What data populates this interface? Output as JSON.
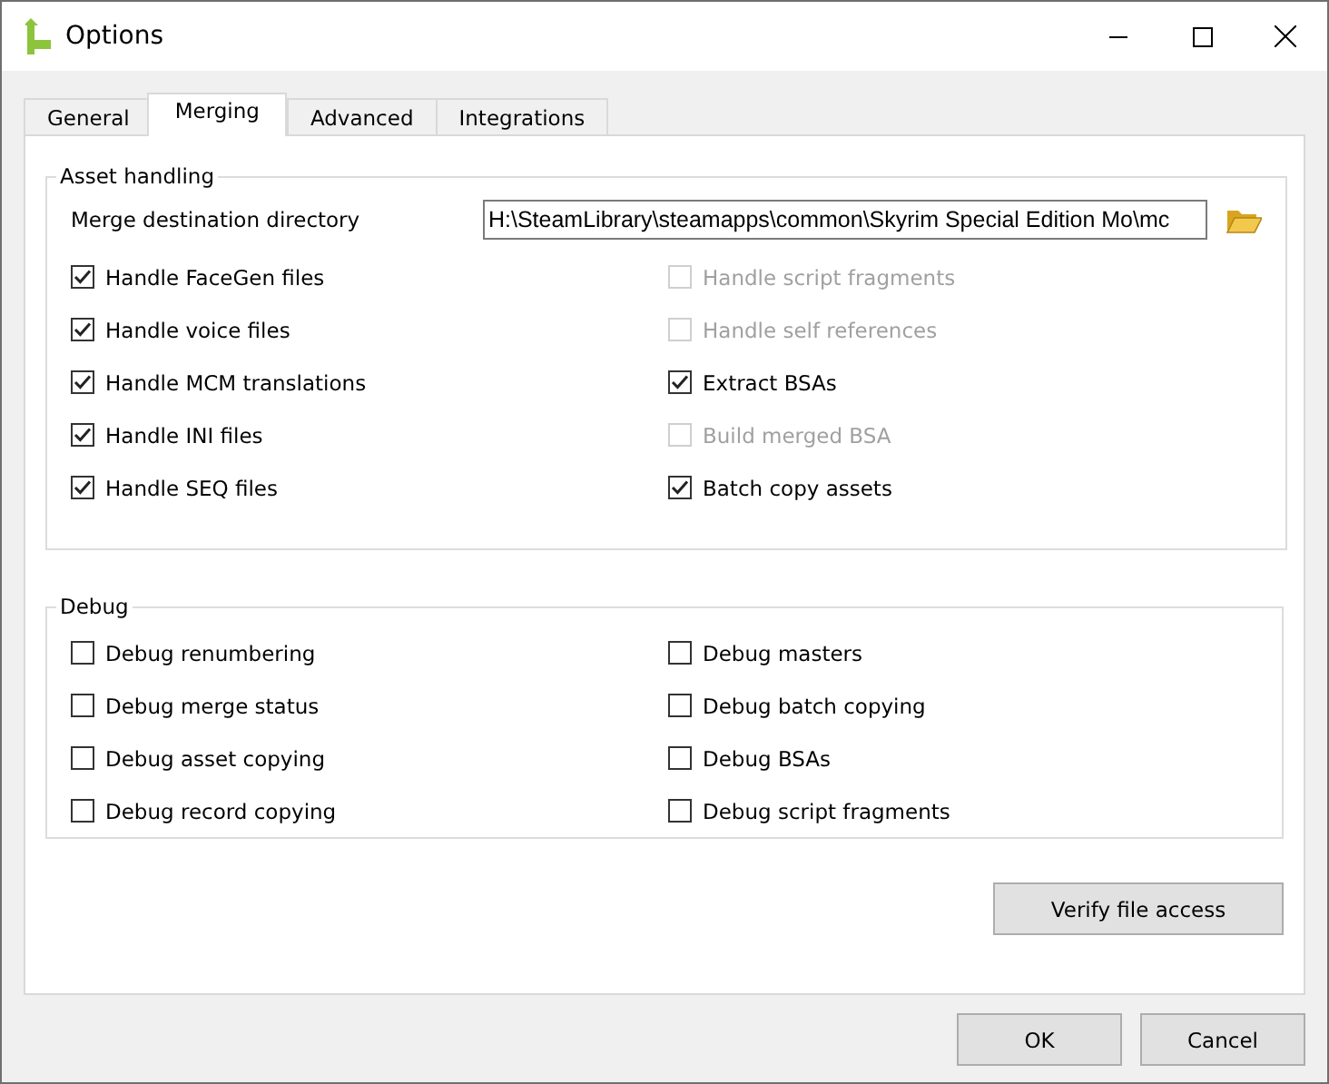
{
  "window": {
    "title": "Options"
  },
  "tabs": [
    {
      "label": "General",
      "selected": false
    },
    {
      "label": "Merging",
      "selected": true
    },
    {
      "label": "Advanced",
      "selected": false
    },
    {
      "label": "Integrations",
      "selected": false
    }
  ],
  "asset_handling": {
    "title": "Asset handling",
    "directory_label": "Merge destination directory",
    "directory_value": "H:\\SteamLibrary\\steamapps\\common\\Skyrim Special Edition Mo\\mc",
    "left_options": [
      {
        "label": "Handle FaceGen files",
        "checked": true,
        "disabled": false
      },
      {
        "label": "Handle voice files",
        "checked": true,
        "disabled": false
      },
      {
        "label": "Handle MCM translations",
        "checked": true,
        "disabled": false
      },
      {
        "label": "Handle INI files",
        "checked": true,
        "disabled": false
      },
      {
        "label": "Handle SEQ files",
        "checked": true,
        "disabled": false
      }
    ],
    "right_options": [
      {
        "label": "Handle script fragments",
        "checked": false,
        "disabled": true
      },
      {
        "label": "Handle self references",
        "checked": false,
        "disabled": true
      },
      {
        "label": "Extract BSAs",
        "checked": true,
        "disabled": false
      },
      {
        "label": "Build merged BSA",
        "checked": false,
        "disabled": true
      },
      {
        "label": "Batch copy assets",
        "checked": true,
        "disabled": false
      }
    ]
  },
  "debug": {
    "title": "Debug",
    "left_options": [
      {
        "label": "Debug renumbering",
        "checked": false,
        "disabled": false
      },
      {
        "label": "Debug merge status",
        "checked": false,
        "disabled": false
      },
      {
        "label": "Debug asset copying",
        "checked": false,
        "disabled": false
      },
      {
        "label": "Debug record copying",
        "checked": false,
        "disabled": false
      }
    ],
    "right_options": [
      {
        "label": "Debug masters",
        "checked": false,
        "disabled": false
      },
      {
        "label": "Debug batch copying",
        "checked": false,
        "disabled": false
      },
      {
        "label": "Debug BSAs",
        "checked": false,
        "disabled": false
      },
      {
        "label": "Debug script fragments",
        "checked": false,
        "disabled": false
      }
    ]
  },
  "verify_button": "Verify file access",
  "buttons": [
    "OK",
    "Cancel"
  ]
}
